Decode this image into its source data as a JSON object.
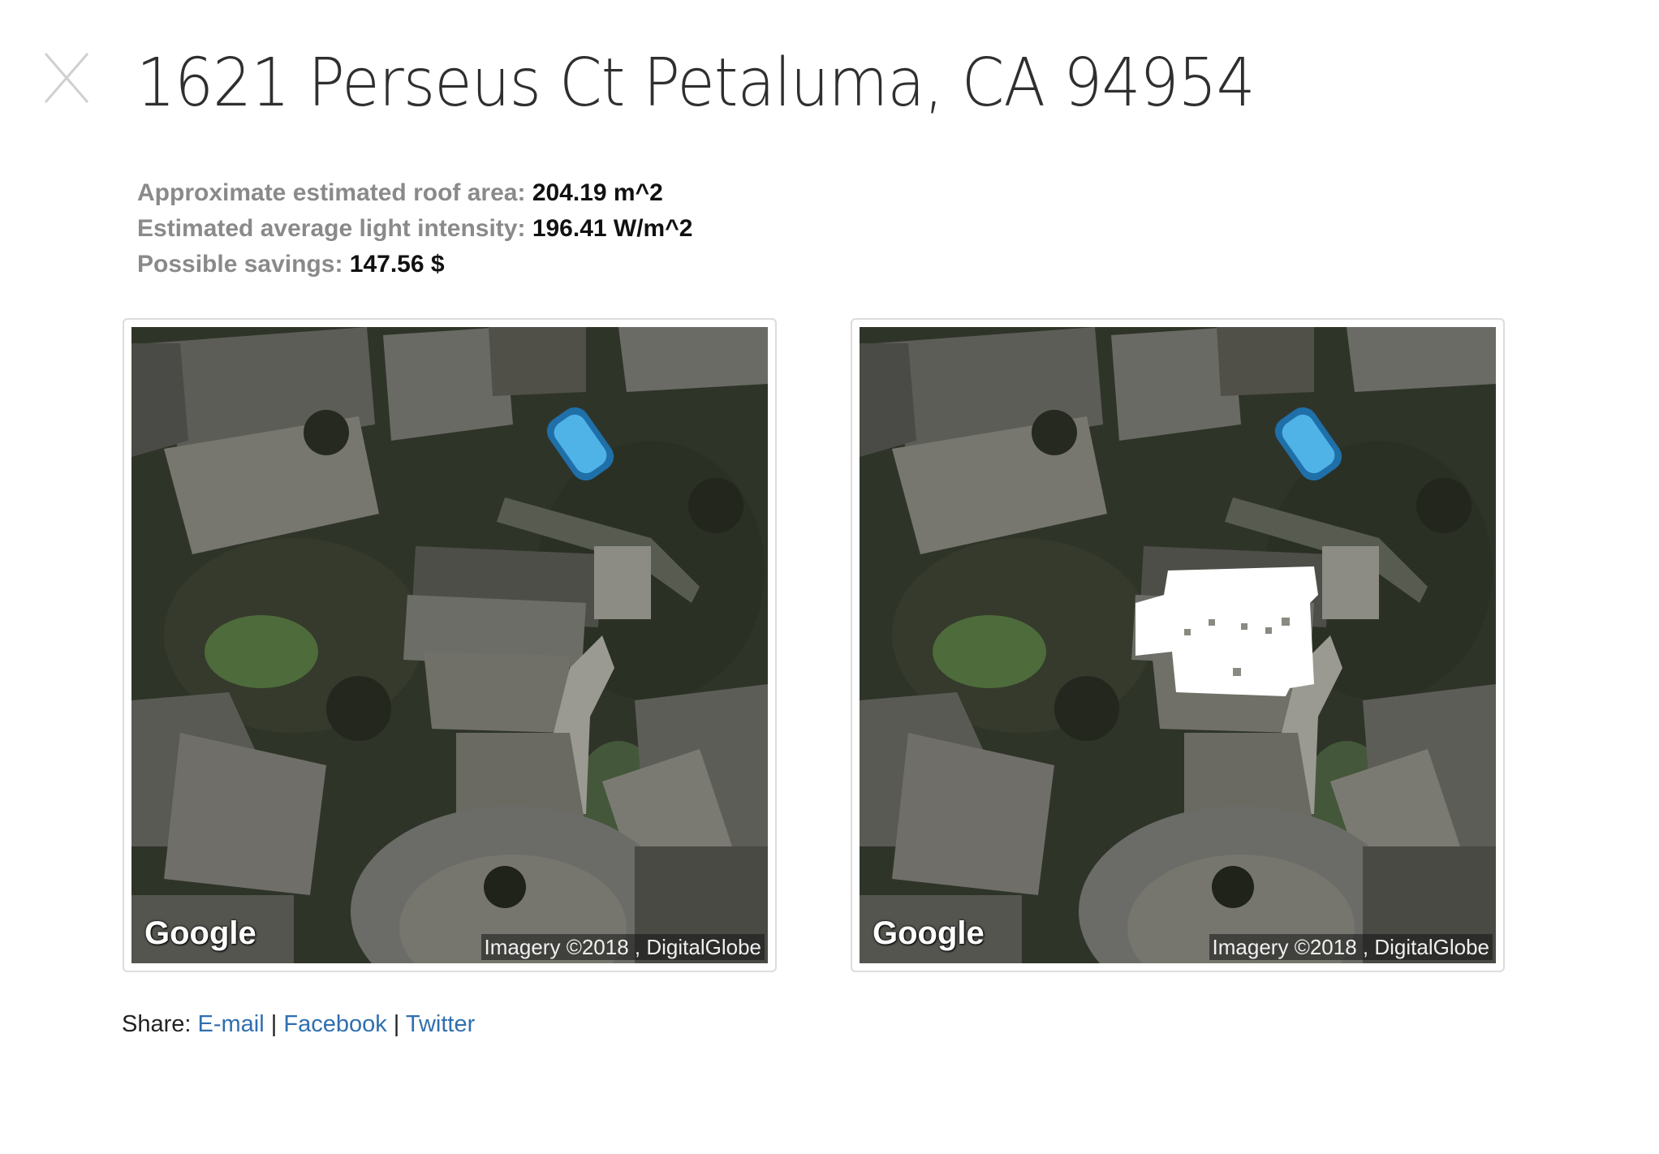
{
  "close": {
    "label": "X"
  },
  "title": "1621 Perseus Ct Petaluma, CA 94954",
  "stats": [
    {
      "label": "Approximate estimated roof area:",
      "value": "204.19 m^2"
    },
    {
      "label": "Estimated average light intensity:",
      "value": "196.41 W/m^2"
    },
    {
      "label": "Possible savings:",
      "value": "147.56 $"
    }
  ],
  "maps": [
    {
      "logo": "Google",
      "attribution": "Imagery ©2018 , DigitalGlobe",
      "roof_overlay": false
    },
    {
      "logo": "Google",
      "attribution": "Imagery ©2018 , DigitalGlobe",
      "roof_overlay": true
    }
  ],
  "share": {
    "label": "Share:",
    "separator": "|",
    "links": [
      "E-mail",
      "Facebook",
      "Twitter"
    ]
  },
  "colors": {
    "link": "#2f6fb0",
    "label_gray": "#8a8a8a",
    "roof_overlay": "#ffffff",
    "pool": "#4fb3e8"
  },
  "icons": {
    "close": "close-icon"
  }
}
